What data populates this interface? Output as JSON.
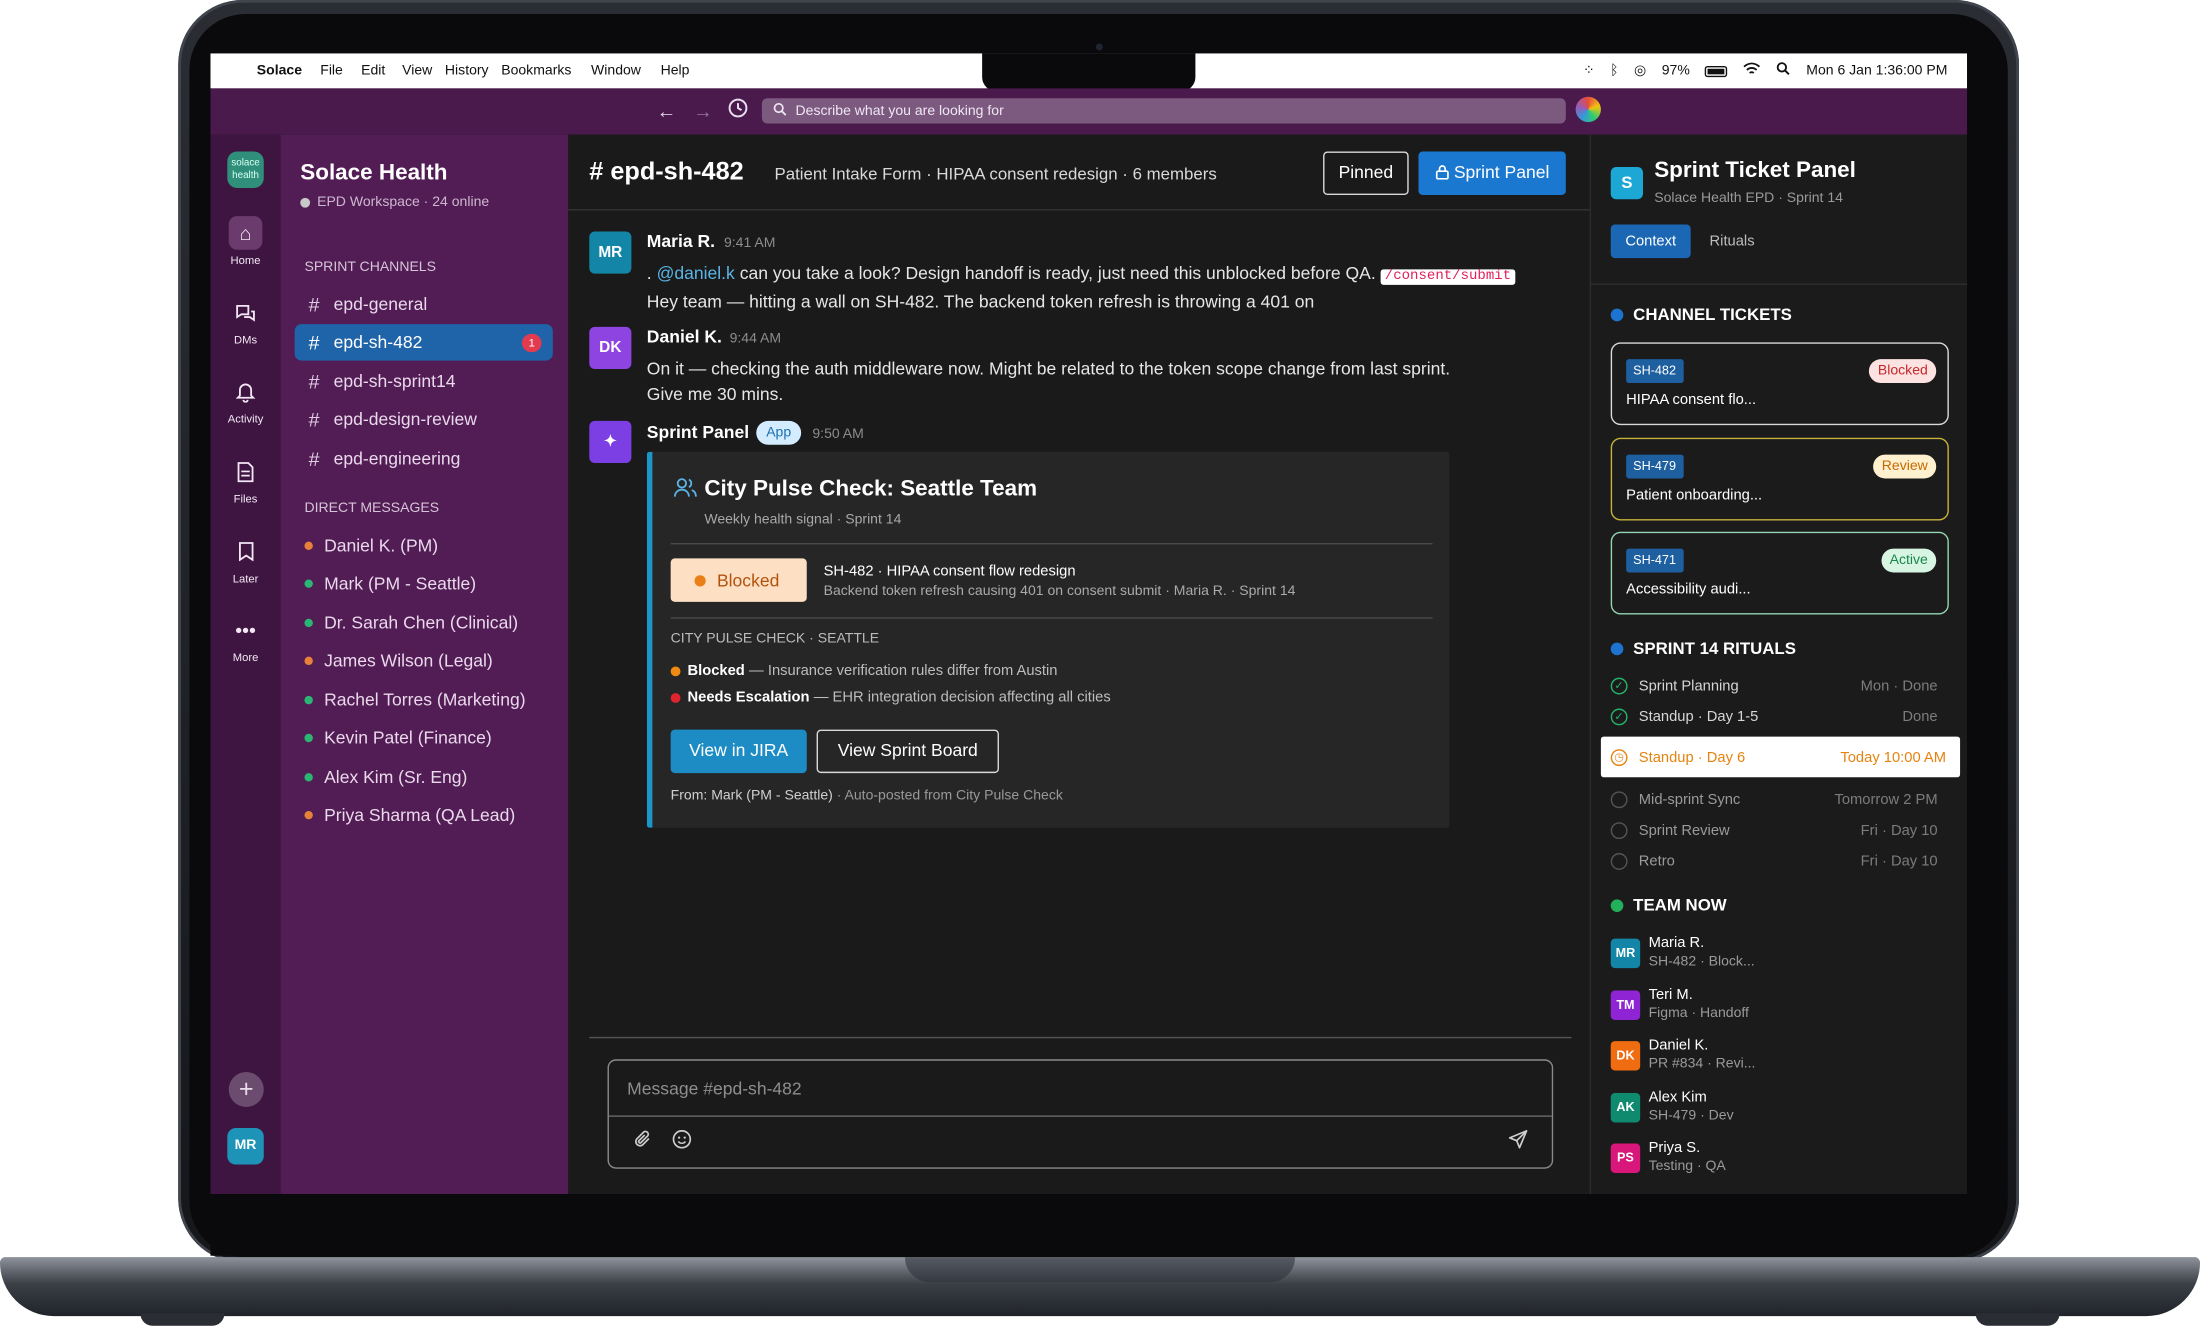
{
  "menubar": {
    "app_name": "Solace",
    "menus": [
      "File",
      "Edit",
      "View",
      "History",
      "Bookmarks",
      "Window",
      "Help"
    ],
    "battery": "97%",
    "datetime": "Mon 6 Jan 1:36:00 PM"
  },
  "browser": {
    "search_placeholder": "Describe what you are looking for"
  },
  "rail": {
    "logo_text": "solace health",
    "items": [
      {
        "label": "Home",
        "icon": "home-icon"
      },
      {
        "label": "DMs",
        "icon": "chat-bubbles-icon"
      },
      {
        "label": "Activity",
        "icon": "bell-icon"
      },
      {
        "label": "Files",
        "icon": "file-icon"
      },
      {
        "label": "Later",
        "icon": "bookmark-icon"
      },
      {
        "label": "More",
        "icon": "more-icon"
      }
    ],
    "add_label": "+",
    "user_initials": "MR"
  },
  "sidebar": {
    "workspace_name": "Solace Health",
    "workspace_sub": "EPD Workspace · 24 online",
    "channels_header": "SPRINT CHANNELS",
    "channels": [
      {
        "name": "epd-general"
      },
      {
        "name": "epd-sh-482",
        "badge": "1"
      },
      {
        "name": "epd-sh-sprint14"
      },
      {
        "name": "epd-design-review"
      },
      {
        "name": "epd-engineering"
      }
    ],
    "dm_header": "DIRECT MESSAGES",
    "dms": [
      {
        "name": "Daniel K. (PM)",
        "status_color": "#e6813a"
      },
      {
        "name": "Mark (PM - Seattle)",
        "status_color": "#2bb673"
      },
      {
        "name": "Dr. Sarah Chen (Clinical)",
        "status_color": "#2bb673"
      },
      {
        "name": "James Wilson (Legal)",
        "status_color": "#e6813a"
      },
      {
        "name": "Rachel Torres (Marketing)",
        "status_color": "#2bb673"
      },
      {
        "name": "Kevin Patel (Finance)",
        "status_color": "#2bb673"
      },
      {
        "name": "Alex Kim (Sr. Eng)",
        "status_color": "#2bb673"
      },
      {
        "name": "Priya Sharma (QA Lead)",
        "status_color": "#e6813a"
      }
    ]
  },
  "channel": {
    "name": "# epd-sh-482",
    "description": "Patient Intake Form · HIPAA consent redesign · 6 members",
    "pinned_label": "Pinned",
    "sprint_panel_label": "Sprint Panel"
  },
  "messages": [
    {
      "initials": "MR",
      "author": "Maria R.",
      "time": "9:41 AM",
      "line1_prefix": ". ",
      "mention": "@daniel.k",
      "line1_text": " can you take a look? Design handoff is ready, just need this unblocked before QA. ",
      "code": "/consent/submit",
      "line2": "Hey team — hitting a wall on SH-482. The backend token refresh is throwing a 401 on"
    },
    {
      "initials": "DK",
      "author": "Daniel K.",
      "time": "9:44 AM",
      "line1": "On it — checking the auth middleware now. Might be related to the token scope change from last sprint.",
      "line2": "Give me 30 mins."
    }
  ],
  "app_message": {
    "author": "Sprint Panel",
    "tag": "App",
    "time": "9:50 AM",
    "card": {
      "title": "City Pulse Check: Seattle Team",
      "subtitle": "Weekly health signal · Sprint 14",
      "status": "Blocked",
      "ticket_title": "SH-482 · HIPAA consent flow redesign",
      "ticket_sub": "Backend token refresh causing 401 on consent submit · Maria R. ·  Sprint 14",
      "pulse_header": "CITY PULSE CHECK · SEATTLE",
      "pulse_items": [
        {
          "label": "Blocked",
          "text": "— Insurance verification rules differ from Austin",
          "color": "#f08a12"
        },
        {
          "label": "Needs Escalation",
          "text": "— EHR integration decision affecting all cities",
          "color": "#e0242e"
        }
      ],
      "jira_button": "View in JIRA",
      "board_button": "View Sprint Board",
      "from_label": "From: Mark (PM - Seattle)",
      "from_suffix": " · Auto-posted from City Pulse Check"
    }
  },
  "composer": {
    "placeholder": "Message #epd-sh-482"
  },
  "right_panel": {
    "logo": "S",
    "title": "Sprint Ticket Panel",
    "subtitle": "Solace Health EPD · Sprint 14",
    "tabs": [
      "Context",
      "Rituals"
    ],
    "tickets_header": "CHANNEL TICKETS",
    "tickets": [
      {
        "id": "SH-482",
        "status": "Blocked",
        "name": "HIPAA consent flo...",
        "status_bg": "#fde2e2",
        "status_fg": "#c62828",
        "border": "#d9d9d9"
      },
      {
        "id": "SH-479",
        "status": "Review",
        "name": "Patient onboarding...",
        "status_bg": "#fff0cf",
        "status_fg": "#c66a00",
        "border": "#c9b23c"
      },
      {
        "id": "SH-471",
        "status": "Active",
        "name": "Accessibility audi...",
        "status_bg": "#d8f5e4",
        "status_fg": "#18874a",
        "border": "#93d6b2"
      }
    ],
    "rituals_header": "SPRINT 14 RITUALS",
    "rituals": [
      {
        "name": "Sprint Planning",
        "time": "Mon · Done",
        "state": "done"
      },
      {
        "name": "Standup · Day 1-5",
        "time": "Done",
        "state": "done"
      },
      {
        "name": "Standup · Day 6",
        "time": "Today 10:00 AM",
        "state": "current"
      },
      {
        "name": "Mid-sprint Sync",
        "time": "Tomorrow 2 PM",
        "state": "upcoming"
      },
      {
        "name": "Sprint Review",
        "time": "Fri · Day 10",
        "state": "upcoming"
      },
      {
        "name": "Retro",
        "time": "Fri · Day 10",
        "state": "upcoming"
      }
    ],
    "team_header": "TEAM NOW",
    "team": [
      {
        "initials": "MR",
        "name": "Maria R.",
        "status": "SH-482 · Block...",
        "color": "#1386a8"
      },
      {
        "initials": "TM",
        "name": "Teri M.",
        "status": "Figma · Handoff",
        "color": "#8e24d4"
      },
      {
        "initials": "DK",
        "name": "Daniel K.",
        "status": "PR #834 · Revi...",
        "color": "#ef6c10"
      },
      {
        "initials": "AK",
        "name": "Alex Kim",
        "status": "SH-479 · Dev",
        "color": "#0f8a6f"
      },
      {
        "initials": "PS",
        "name": "Priya S.",
        "status": "Testing · QA",
        "color": "#d9167a"
      }
    ]
  }
}
